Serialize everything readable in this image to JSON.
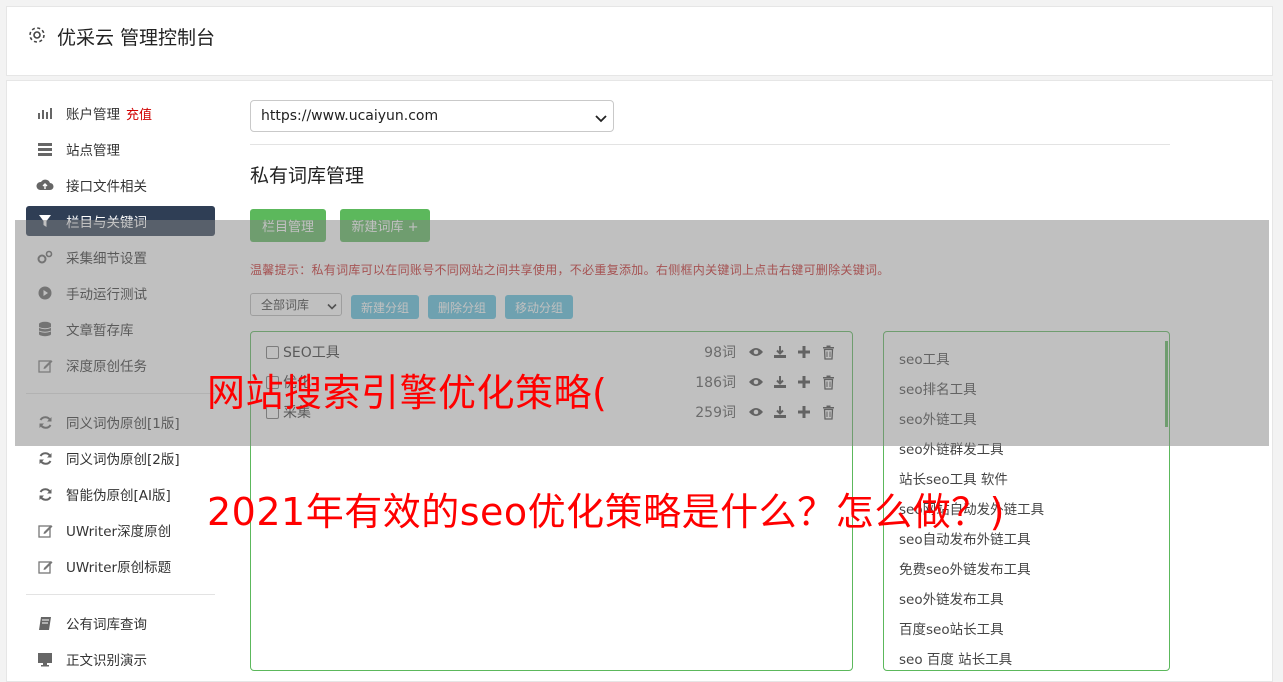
{
  "app": {
    "title": "优采云 管理控制台",
    "icon": "gear-icon"
  },
  "sidebar": {
    "items": [
      {
        "label": "账户管理",
        "badge": "充值",
        "icon": "bar-chart-icon"
      },
      {
        "label": "站点管理",
        "icon": "server-icon"
      },
      {
        "label": "接口文件相关",
        "icon": "cloud-upload-icon"
      },
      {
        "label": "栏目与关键词",
        "icon": "filter-icon",
        "active": true
      },
      {
        "label": "采集细节设置",
        "icon": "cogs-icon"
      },
      {
        "label": "手动运行测试",
        "icon": "play-circle-icon"
      },
      {
        "label": "文章暂存库",
        "icon": "database-icon"
      },
      {
        "label": "深度原创任务",
        "icon": "edit-icon"
      },
      {
        "label": "同义词伪原创[1版]",
        "icon": "refresh-icon"
      },
      {
        "label": "同义词伪原创[2版]",
        "icon": "refresh-icon"
      },
      {
        "label": "智能伪原创[AI版]",
        "icon": "refresh-icon"
      },
      {
        "label": "UWriter深度原创",
        "icon": "edit-icon"
      },
      {
        "label": "UWriter原创标题",
        "icon": "edit-icon"
      },
      {
        "label": "公有词库查询",
        "icon": "book-icon"
      },
      {
        "label": "正文识别演示",
        "icon": "monitor-icon"
      }
    ]
  },
  "main": {
    "site_select": "https://www.ucaiyun.com",
    "section_title": "私有词库管理",
    "buttons": {
      "column_manage": "栏目管理",
      "new_lib": "新建词库 +"
    },
    "tip": "温馨提示：私有词库可以在同账号不同网站之间共享使用，不必重复添加。右侧框内关键词上点击右键可删除关键词。",
    "filter_select": "全部词库",
    "group_buttons": {
      "new_group": "新建分组",
      "delete_group": "删除分组",
      "move_group": "移动分组"
    },
    "libraries": [
      {
        "name": "SEO工具",
        "count": "98词"
      },
      {
        "name": "优化",
        "count": "186词"
      },
      {
        "name": "采集",
        "count": "259词"
      }
    ],
    "keywords": [
      "seo工具",
      "seo排名工具",
      "seo外链工具",
      "seo外链群发工具",
      "站长seo工具 软件",
      "seo网站自动发外链工具",
      "seo自动发布外链工具",
      "免费seo外链发布工具",
      "seo外链发布工具",
      "百度seo站长工具",
      "seo 百度 站长工具"
    ]
  },
  "overlay": {
    "line1": "网站搜索引擎优化策略(",
    "line2": "2021年有效的seo优化策略是什么？怎么做？)"
  },
  "colors": {
    "accent_green": "#5cb85c",
    "accent_blue": "#5bc0de",
    "sidebar_active": "#2f3e55",
    "headline_red": "#ff0000"
  }
}
